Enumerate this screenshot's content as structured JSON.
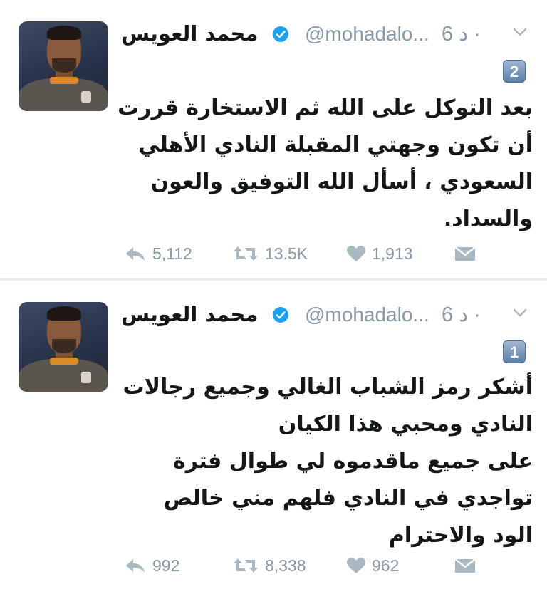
{
  "tweets": [
    {
      "author_name": "محمد العويس",
      "handle": "@mohadalo...",
      "time": "6 د ·",
      "thread_number": "2",
      "text_lines": [
        "بعد التوكل على الله ثم الاستخارة قررت",
        "أن تكون وجهتي المقبلة النادي الأهلي",
        "السعودي ، أسأل الله التوفيق والعون",
        "والسداد."
      ],
      "replies": "5,112",
      "retweets": "13.5K",
      "likes": "1,913"
    },
    {
      "author_name": "محمد العويس",
      "handle": "@mohadalo...",
      "time": "6 د ·",
      "thread_number": "1",
      "text_lines": [
        "أشكر رمز الشباب الغالي وجميع رجالات",
        "النادي ومحبي هذا الكيان",
        "على جميع ماقدموه لي طوال فترة",
        "تواجدي في النادي فلهم مني خالص",
        "الود والاحترام"
      ],
      "replies": "992",
      "retweets": "8,338",
      "likes": "962"
    }
  ],
  "icons": {
    "verified": "verified-badge-icon",
    "reply": "reply-icon",
    "retweet": "retweet-icon",
    "like": "heart-icon",
    "message": "direct-message-icon",
    "more": "chevron-down-icon"
  },
  "colors": {
    "verified_blue": "#1da1f2",
    "muted_gray": "#8899a6",
    "text_dark": "#14171a"
  }
}
